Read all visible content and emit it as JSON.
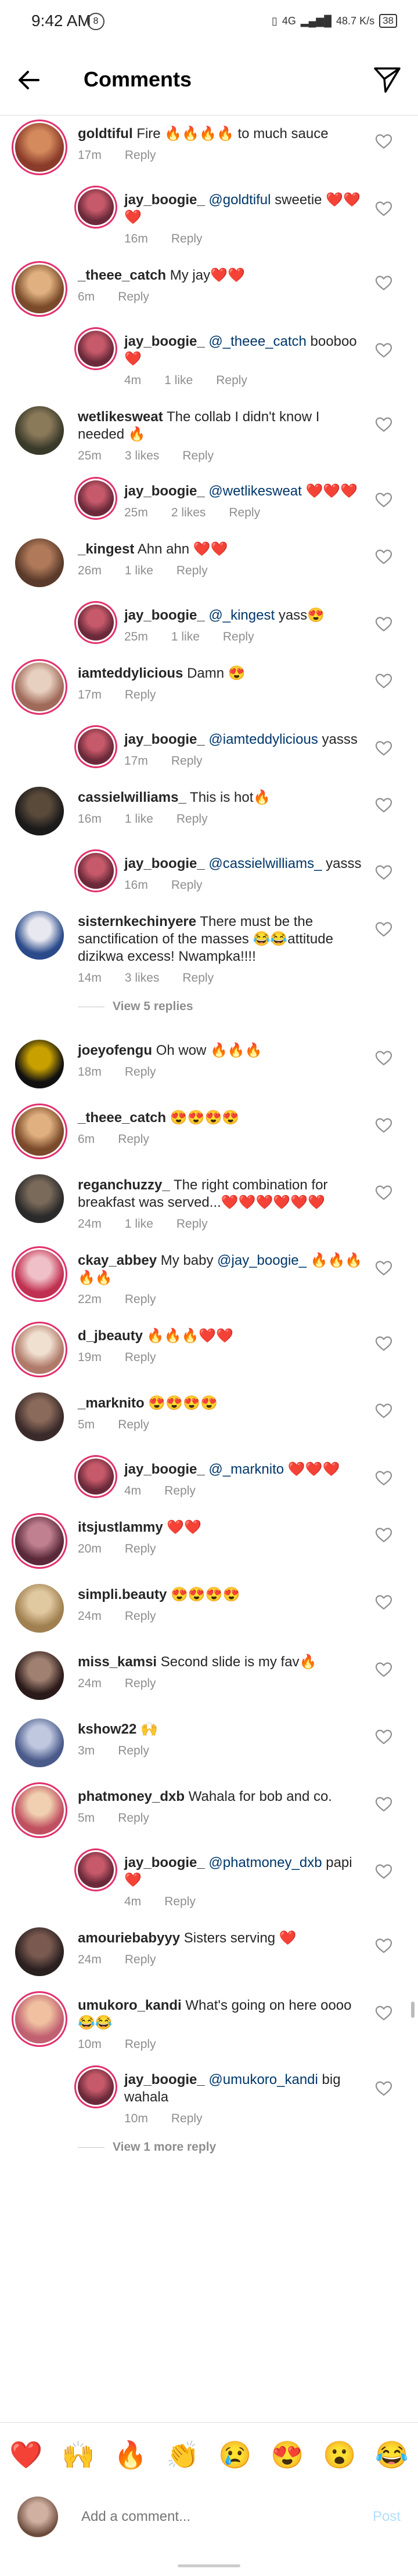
{
  "status_bar": {
    "time": "9:42 AM",
    "clock_icon": "8",
    "signal_text": "4G",
    "net_speed": "48.7 K/s",
    "battery": "38"
  },
  "header": {
    "title": "Comments",
    "back_icon": "arrow-left",
    "send_icon": "paper-plane"
  },
  "reply_label": "Reply",
  "comments": [
    {
      "user": "goldtiful",
      "text": "Fire 🔥🔥🔥🔥 to much sauce",
      "time": "17m",
      "likes": "",
      "reply": false,
      "av": [
        "#8a3b2a",
        "#d48a5c"
      ],
      "ring": true
    },
    {
      "user": "jay_boogie_",
      "mention": "@goldtiful",
      "text": "sweetie ❤️❤️❤️",
      "time": "16m",
      "likes": "",
      "reply": true,
      "av": [
        "#6b2a3a",
        "#c75a6a"
      ],
      "ring": true
    },
    {
      "user": "_theee_catch",
      "text": "My jay❤️❤️",
      "time": "6m",
      "likes": "",
      "reply": false,
      "av": [
        "#7a4a2a",
        "#e0b080"
      ],
      "ring": true
    },
    {
      "user": "jay_boogie_",
      "mention": "@_theee_catch",
      "text": "booboo ❤️",
      "time": "4m",
      "likes": "1 like",
      "reply": true,
      "av": [
        "#6b2a3a",
        "#c75a6a"
      ],
      "ring": true
    },
    {
      "user": "wetlikesweat",
      "text": "The collab I didn't know I needed 🔥",
      "time": "25m",
      "likes": "3 likes",
      "reply": false,
      "av": [
        "#3a3a2a",
        "#8a7a5a"
      ],
      "ring": false
    },
    {
      "user": "jay_boogie_",
      "mention": "@wetlikesweat",
      "text": "❤️❤️❤️",
      "time": "25m",
      "likes": "2 likes",
      "reply": true,
      "av": [
        "#6b2a3a",
        "#c75a6a"
      ],
      "ring": true
    },
    {
      "user": "_kingest",
      "text": "Ahn ahn ❤️❤️",
      "time": "26m",
      "likes": "1 like",
      "reply": false,
      "av": [
        "#5a3a2a",
        "#b07a5a"
      ],
      "ring": false
    },
    {
      "user": "jay_boogie_",
      "mention": "@_kingest",
      "text": "yass😍",
      "time": "25m",
      "likes": "1 like",
      "reply": true,
      "av": [
        "#6b2a3a",
        "#c75a6a"
      ],
      "ring": true
    },
    {
      "user": "iamteddylicious",
      "text": "Damn 😍",
      "time": "17m",
      "likes": "",
      "reply": false,
      "av": [
        "#a06a5a",
        "#e8d0c0"
      ],
      "ring": true
    },
    {
      "user": "jay_boogie_",
      "mention": "@iamteddylicious",
      "text": "yasss",
      "time": "17m",
      "likes": "",
      "reply": true,
      "av": [
        "#6b2a3a",
        "#c75a6a"
      ],
      "ring": true
    },
    {
      "user": "cassielwilliams_",
      "text": "This is hot🔥",
      "time": "16m",
      "likes": "1 like",
      "reply": false,
      "av": [
        "#1a1a1a",
        "#5a4a3a"
      ],
      "ring": false
    },
    {
      "user": "jay_boogie_",
      "mention": "@cassielwilliams_",
      "text": "yasss",
      "time": "16m",
      "likes": "",
      "reply": true,
      "av": [
        "#6b2a3a",
        "#c75a6a"
      ],
      "ring": true
    },
    {
      "user": "sisternkechinyere",
      "text": "There must be the sanctification of the masses 😂😂attitude dizikwa excess! Nwampka!!!!",
      "time": "14m",
      "likes": "3 likes",
      "reply": false,
      "av": [
        "#2a4a8a",
        "#e8e8f0"
      ],
      "ring": false
    },
    {
      "view_replies": "View 5 replies"
    },
    {
      "user": "joeyofengu",
      "text": "Oh wow 🔥🔥🔥",
      "time": "18m",
      "likes": "",
      "reply": false,
      "av": [
        "#111111",
        "#c8a000"
      ],
      "ring": false
    },
    {
      "user": "_theee_catch",
      "text": "😍😍😍😍",
      "time": "6m",
      "likes": "",
      "reply": false,
      "av": [
        "#7a4a2a",
        "#e0b080"
      ],
      "ring": true
    },
    {
      "user": "reganchuzzy_",
      "text": "The right combination for breakfast was served...❤️❤️❤️❤️❤️❤️",
      "time": "24m",
      "likes": "1 like",
      "reply": false,
      "av": [
        "#2a2a2a",
        "#7a6a5a"
      ],
      "ring": false
    },
    {
      "user": "ckay_abbey",
      "text": "My baby",
      "mention_after": "@jay_boogie_",
      "text2": "🔥🔥🔥🔥🔥",
      "time": "22m",
      "likes": "",
      "reply": false,
      "av": [
        "#c03050",
        "#f0c0c8"
      ],
      "ring": true
    },
    {
      "user": "d_jbeauty",
      "text": "🔥🔥🔥❤️❤️",
      "time": "19m",
      "likes": "",
      "reply": false,
      "av": [
        "#b07a6a",
        "#f0e0d0"
      ],
      "ring": true
    },
    {
      "user": "_marknito",
      "text": "😍😍😍😍",
      "time": "5m",
      "likes": "",
      "reply": false,
      "av": [
        "#3a2a2a",
        "#8a6a5a"
      ],
      "ring": false
    },
    {
      "user": "jay_boogie_",
      "mention": "@_marknito",
      "text": "❤️❤️❤️",
      "time": "4m",
      "likes": "",
      "reply": true,
      "av": [
        "#6b2a3a",
        "#c75a6a"
      ],
      "ring": true
    },
    {
      "user": "itsjustlammy",
      "text": "❤️❤️",
      "time": "20m",
      "likes": "",
      "reply": false,
      "av": [
        "#5a2a3a",
        "#c08090"
      ],
      "ring": true
    },
    {
      "user": "simpli.beauty",
      "text": "😍😍😍😍",
      "time": "24m",
      "likes": "",
      "reply": false,
      "av": [
        "#a08050",
        "#e0c8a0"
      ],
      "ring": false
    },
    {
      "user": "miss_kamsi",
      "text": "Second slide is my fav🔥",
      "time": "24m",
      "likes": "",
      "reply": false,
      "av": [
        "#2a1a1a",
        "#a08070"
      ],
      "ring": false
    },
    {
      "user": "kshow22",
      "text": "🙌",
      "time": "3m",
      "likes": "",
      "reply": false,
      "av": [
        "#4a5a8a",
        "#c0c8e0"
      ],
      "ring": false
    },
    {
      "user": "phatmoney_dxb",
      "text": "Wahala for bob and co.",
      "time": "5m",
      "likes": "",
      "reply": false,
      "av": [
        "#c05060",
        "#f0d0b0"
      ],
      "ring": true
    },
    {
      "user": "jay_boogie_",
      "mention": "@phatmoney_dxb",
      "text": "papi ❤️",
      "time": "4m",
      "likes": "",
      "reply": true,
      "av": [
        "#6b2a3a",
        "#c75a6a"
      ],
      "ring": true
    },
    {
      "user": "amouriebabyyy",
      "text": "Sisters serving ❤️",
      "time": "24m",
      "likes": "",
      "reply": false,
      "av": [
        "#2a2020",
        "#7a5a50"
      ],
      "ring": false
    },
    {
      "user": "umukoro_kandi",
      "text": "What's going on here oooo😂😂",
      "time": "10m",
      "likes": "",
      "reply": false,
      "av": [
        "#c06070",
        "#f0c0a0"
      ],
      "ring": true
    },
    {
      "user": "jay_boogie_",
      "mention": "@umukoro_kandi",
      "text": "big wahala",
      "time": "10m",
      "likes": "",
      "reply": true,
      "av": [
        "#6b2a3a",
        "#c75a6a"
      ],
      "ring": true
    },
    {
      "view_replies": "View 1 more reply"
    }
  ],
  "emoji_bar": [
    "❤️",
    "🙌",
    "🔥",
    "👏",
    "😢",
    "😍",
    "😮",
    "😂"
  ],
  "input": {
    "placeholder": "Add a comment...",
    "post_label": "Post"
  },
  "colors": {
    "accent": "#0095f6",
    "mention": "#00376b",
    "meta": "#8e8e8e",
    "ring": "#e1306c"
  }
}
